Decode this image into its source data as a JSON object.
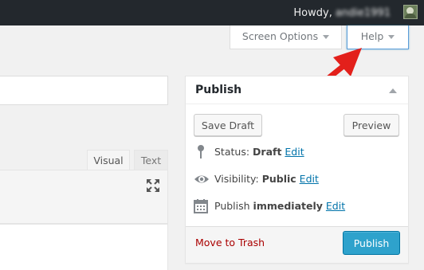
{
  "admin_bar": {
    "greeting": "Howdy,",
    "username": "andie1991"
  },
  "screen_meta": {
    "screen_options_label": "Screen Options",
    "help_label": "Help"
  },
  "editor": {
    "tab_visual": "Visual",
    "tab_text": "Text"
  },
  "publish_box": {
    "title": "Publish",
    "save_draft_label": "Save Draft",
    "preview_label": "Preview",
    "status_label": "Status:",
    "status_value": "Draft",
    "visibility_label": "Visibility:",
    "visibility_value": "Public",
    "publish_label": "Publish",
    "publish_value": "immediately",
    "edit_link": "Edit",
    "trash_label": "Move to Trash",
    "publish_button_label": "Publish"
  },
  "colors": {
    "admin_bar_bg": "#23282d",
    "primary_button": "#2ea2cc",
    "link": "#0073aa",
    "trash": "#a00000",
    "annotation_arrow": "#e3201b"
  }
}
